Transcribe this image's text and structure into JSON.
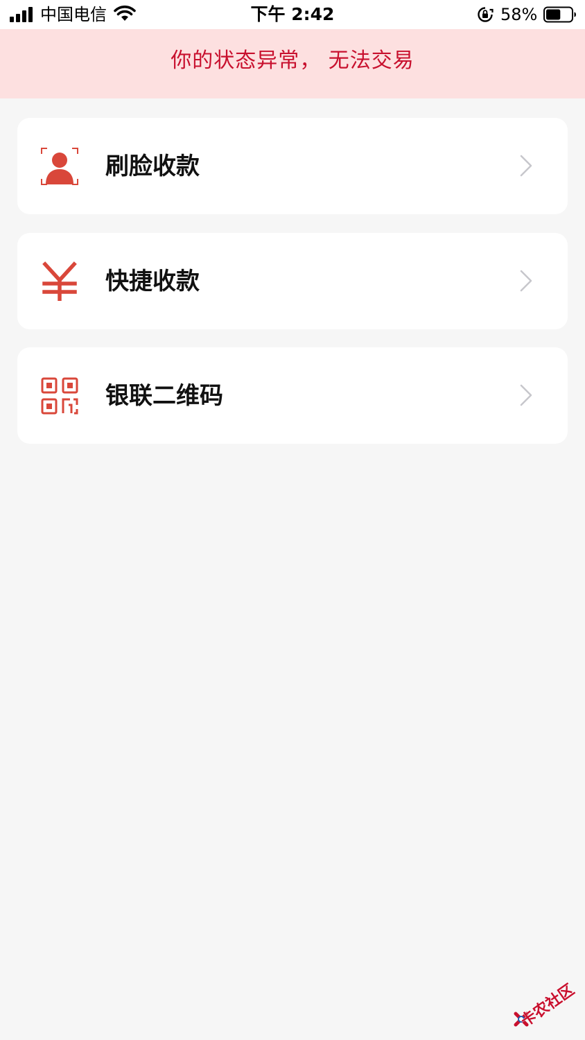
{
  "status_bar": {
    "carrier": "中国电信",
    "time": "下午 2:42",
    "battery_percent": "58%",
    "battery_level": 0.58
  },
  "alert": {
    "message": "你的状态异常， 无法交易",
    "color": "#c8102e",
    "background": "#fde0e0"
  },
  "menu": {
    "items": [
      {
        "label": "刷脸收款",
        "icon": "face-recognition-icon"
      },
      {
        "label": "快捷收款",
        "icon": "yen-icon"
      },
      {
        "label": "银联二维码",
        "icon": "qr-code-icon"
      }
    ]
  },
  "accent_color": "#d9473a",
  "watermark": {
    "text": "卡农社区"
  }
}
